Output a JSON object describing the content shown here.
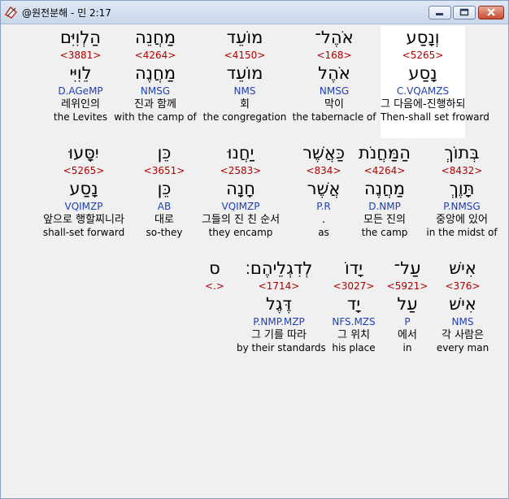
{
  "window": {
    "title": "@원전분해 - 민 2:17"
  },
  "rows": [
    [
      {
        "heb": "וְנָסַע",
        "strong": "<5265>",
        "lemma": "נָסַע",
        "parse": "C.VQAMZS",
        "kor": "그 다음에-진행하되",
        "eng": "Then-shall set froward",
        "selected": true
      },
      {
        "heb": "אֹהֶל־",
        "strong": "<168>",
        "lemma": "אֹהֶל",
        "parse": "NMSG",
        "kor": "막이",
        "eng": "the tabernacle of"
      },
      {
        "heb": "מוֹעֵד",
        "strong": "<4150>",
        "lemma": "מוֹעֵד",
        "parse": "NMS",
        "kor": "회",
        "eng": "the congregation"
      },
      {
        "heb": "מַחֲנֵה",
        "strong": "<4264>",
        "lemma": "מַחֲנֶה",
        "parse": "NMSG",
        "kor": "진과 함께",
        "eng": "with the camp of"
      },
      {
        "heb": "הַלְוִיִּם",
        "strong": "<3881>",
        "lemma": "לֵוִיִּי",
        "parse": "D.AGeMP",
        "kor": "레위인의",
        "eng": "the Levites"
      }
    ],
    [
      {
        "heb": "בְּתוֹךְ",
        "strong": "<8432>",
        "lemma": "תָּוֶךְ",
        "parse": "P.NMSG",
        "kor": "중앙에 있어",
        "eng": "in the midst of"
      },
      {
        "heb": "הַמַּחֲנֹת",
        "strong": "<4264>",
        "lemma": "מַחֲנֶה",
        "parse": "D.NMP",
        "kor": "모든 진의",
        "eng": "the camp"
      },
      {
        "heb": "כַּאֲשֶׁר",
        "strong": "<834>",
        "lemma": "אֲשֶׁר",
        "parse": "P.R",
        "kor": ".",
        "eng": "as"
      },
      {
        "heb": "יַחֲנוּ",
        "strong": "<2583>",
        "lemma": "חָנָה",
        "parse": "VQIMZP",
        "kor": "그들의 진 친 순서",
        "eng": "they encamp"
      },
      {
        "heb": "כֵּן",
        "strong": "<3651>",
        "lemma": "כֵּן",
        "parse": "AB",
        "kor": "대로",
        "eng": "so-they"
      },
      {
        "heb": "יִסָּעוּ",
        "strong": "<5265>",
        "lemma": "נָסַע",
        "parse": "VQIMZP",
        "kor": "앞으로 행할찌니라",
        "eng": "shall-set forward"
      }
    ],
    [
      {
        "heb": "אִישׁ",
        "strong": "<376>",
        "lemma": "אִישׁ",
        "parse": "NMS",
        "kor": "각 사람은",
        "eng": "every man"
      },
      {
        "heb": "עַל־",
        "strong": "<5921>",
        "lemma": "עַל",
        "parse": "P",
        "kor": "에서",
        "eng": "in"
      },
      {
        "heb": "יָדוֹ",
        "strong": "<3027>",
        "lemma": "יָד",
        "parse": "NFS.MZS",
        "kor": "그 위치",
        "eng": "his place"
      },
      {
        "heb": "לְדִגְלֵיהֶם׃",
        "strong": "<1714>",
        "lemma": "דֶּגֶל",
        "parse": "P.NMP.MZP",
        "kor": "그 기를 따라",
        "eng": "by their standards"
      },
      {
        "heb": "ס",
        "strong": "<.>",
        "lemma": "",
        "parse": "",
        "kor": "",
        "eng": ""
      }
    ]
  ]
}
